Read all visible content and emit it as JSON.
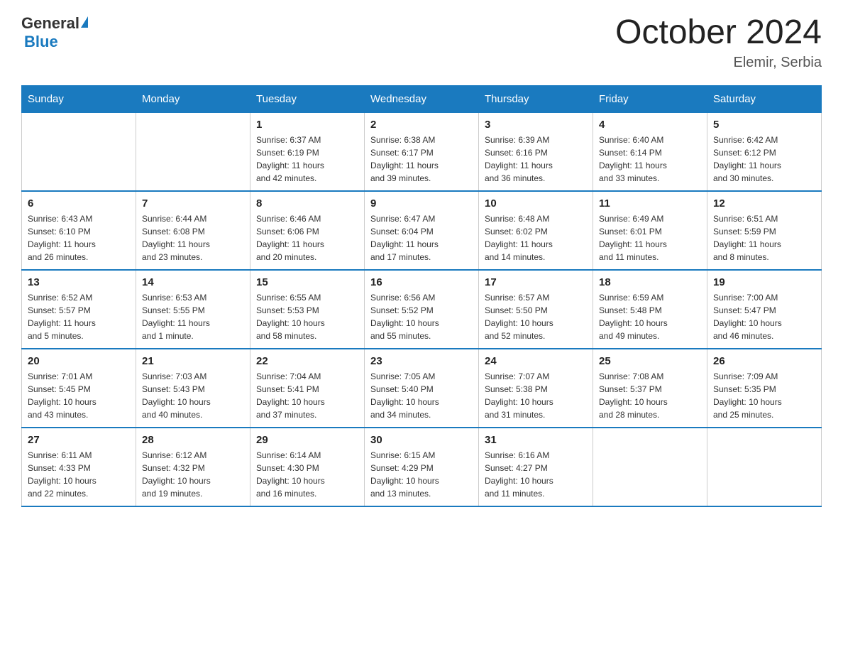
{
  "header": {
    "logo_general": "General",
    "logo_blue": "Blue",
    "month_title": "October 2024",
    "location": "Elemir, Serbia"
  },
  "weekdays": [
    "Sunday",
    "Monday",
    "Tuesday",
    "Wednesday",
    "Thursday",
    "Friday",
    "Saturday"
  ],
  "weeks": [
    [
      {
        "day": "",
        "info": ""
      },
      {
        "day": "",
        "info": ""
      },
      {
        "day": "1",
        "info": "Sunrise: 6:37 AM\nSunset: 6:19 PM\nDaylight: 11 hours\nand 42 minutes."
      },
      {
        "day": "2",
        "info": "Sunrise: 6:38 AM\nSunset: 6:17 PM\nDaylight: 11 hours\nand 39 minutes."
      },
      {
        "day": "3",
        "info": "Sunrise: 6:39 AM\nSunset: 6:16 PM\nDaylight: 11 hours\nand 36 minutes."
      },
      {
        "day": "4",
        "info": "Sunrise: 6:40 AM\nSunset: 6:14 PM\nDaylight: 11 hours\nand 33 minutes."
      },
      {
        "day": "5",
        "info": "Sunrise: 6:42 AM\nSunset: 6:12 PM\nDaylight: 11 hours\nand 30 minutes."
      }
    ],
    [
      {
        "day": "6",
        "info": "Sunrise: 6:43 AM\nSunset: 6:10 PM\nDaylight: 11 hours\nand 26 minutes."
      },
      {
        "day": "7",
        "info": "Sunrise: 6:44 AM\nSunset: 6:08 PM\nDaylight: 11 hours\nand 23 minutes."
      },
      {
        "day": "8",
        "info": "Sunrise: 6:46 AM\nSunset: 6:06 PM\nDaylight: 11 hours\nand 20 minutes."
      },
      {
        "day": "9",
        "info": "Sunrise: 6:47 AM\nSunset: 6:04 PM\nDaylight: 11 hours\nand 17 minutes."
      },
      {
        "day": "10",
        "info": "Sunrise: 6:48 AM\nSunset: 6:02 PM\nDaylight: 11 hours\nand 14 minutes."
      },
      {
        "day": "11",
        "info": "Sunrise: 6:49 AM\nSunset: 6:01 PM\nDaylight: 11 hours\nand 11 minutes."
      },
      {
        "day": "12",
        "info": "Sunrise: 6:51 AM\nSunset: 5:59 PM\nDaylight: 11 hours\nand 8 minutes."
      }
    ],
    [
      {
        "day": "13",
        "info": "Sunrise: 6:52 AM\nSunset: 5:57 PM\nDaylight: 11 hours\nand 5 minutes."
      },
      {
        "day": "14",
        "info": "Sunrise: 6:53 AM\nSunset: 5:55 PM\nDaylight: 11 hours\nand 1 minute."
      },
      {
        "day": "15",
        "info": "Sunrise: 6:55 AM\nSunset: 5:53 PM\nDaylight: 10 hours\nand 58 minutes."
      },
      {
        "day": "16",
        "info": "Sunrise: 6:56 AM\nSunset: 5:52 PM\nDaylight: 10 hours\nand 55 minutes."
      },
      {
        "day": "17",
        "info": "Sunrise: 6:57 AM\nSunset: 5:50 PM\nDaylight: 10 hours\nand 52 minutes."
      },
      {
        "day": "18",
        "info": "Sunrise: 6:59 AM\nSunset: 5:48 PM\nDaylight: 10 hours\nand 49 minutes."
      },
      {
        "day": "19",
        "info": "Sunrise: 7:00 AM\nSunset: 5:47 PM\nDaylight: 10 hours\nand 46 minutes."
      }
    ],
    [
      {
        "day": "20",
        "info": "Sunrise: 7:01 AM\nSunset: 5:45 PM\nDaylight: 10 hours\nand 43 minutes."
      },
      {
        "day": "21",
        "info": "Sunrise: 7:03 AM\nSunset: 5:43 PM\nDaylight: 10 hours\nand 40 minutes."
      },
      {
        "day": "22",
        "info": "Sunrise: 7:04 AM\nSunset: 5:41 PM\nDaylight: 10 hours\nand 37 minutes."
      },
      {
        "day": "23",
        "info": "Sunrise: 7:05 AM\nSunset: 5:40 PM\nDaylight: 10 hours\nand 34 minutes."
      },
      {
        "day": "24",
        "info": "Sunrise: 7:07 AM\nSunset: 5:38 PM\nDaylight: 10 hours\nand 31 minutes."
      },
      {
        "day": "25",
        "info": "Sunrise: 7:08 AM\nSunset: 5:37 PM\nDaylight: 10 hours\nand 28 minutes."
      },
      {
        "day": "26",
        "info": "Sunrise: 7:09 AM\nSunset: 5:35 PM\nDaylight: 10 hours\nand 25 minutes."
      }
    ],
    [
      {
        "day": "27",
        "info": "Sunrise: 6:11 AM\nSunset: 4:33 PM\nDaylight: 10 hours\nand 22 minutes."
      },
      {
        "day": "28",
        "info": "Sunrise: 6:12 AM\nSunset: 4:32 PM\nDaylight: 10 hours\nand 19 minutes."
      },
      {
        "day": "29",
        "info": "Sunrise: 6:14 AM\nSunset: 4:30 PM\nDaylight: 10 hours\nand 16 minutes."
      },
      {
        "day": "30",
        "info": "Sunrise: 6:15 AM\nSunset: 4:29 PM\nDaylight: 10 hours\nand 13 minutes."
      },
      {
        "day": "31",
        "info": "Sunrise: 6:16 AM\nSunset: 4:27 PM\nDaylight: 10 hours\nand 11 minutes."
      },
      {
        "day": "",
        "info": ""
      },
      {
        "day": "",
        "info": ""
      }
    ]
  ]
}
